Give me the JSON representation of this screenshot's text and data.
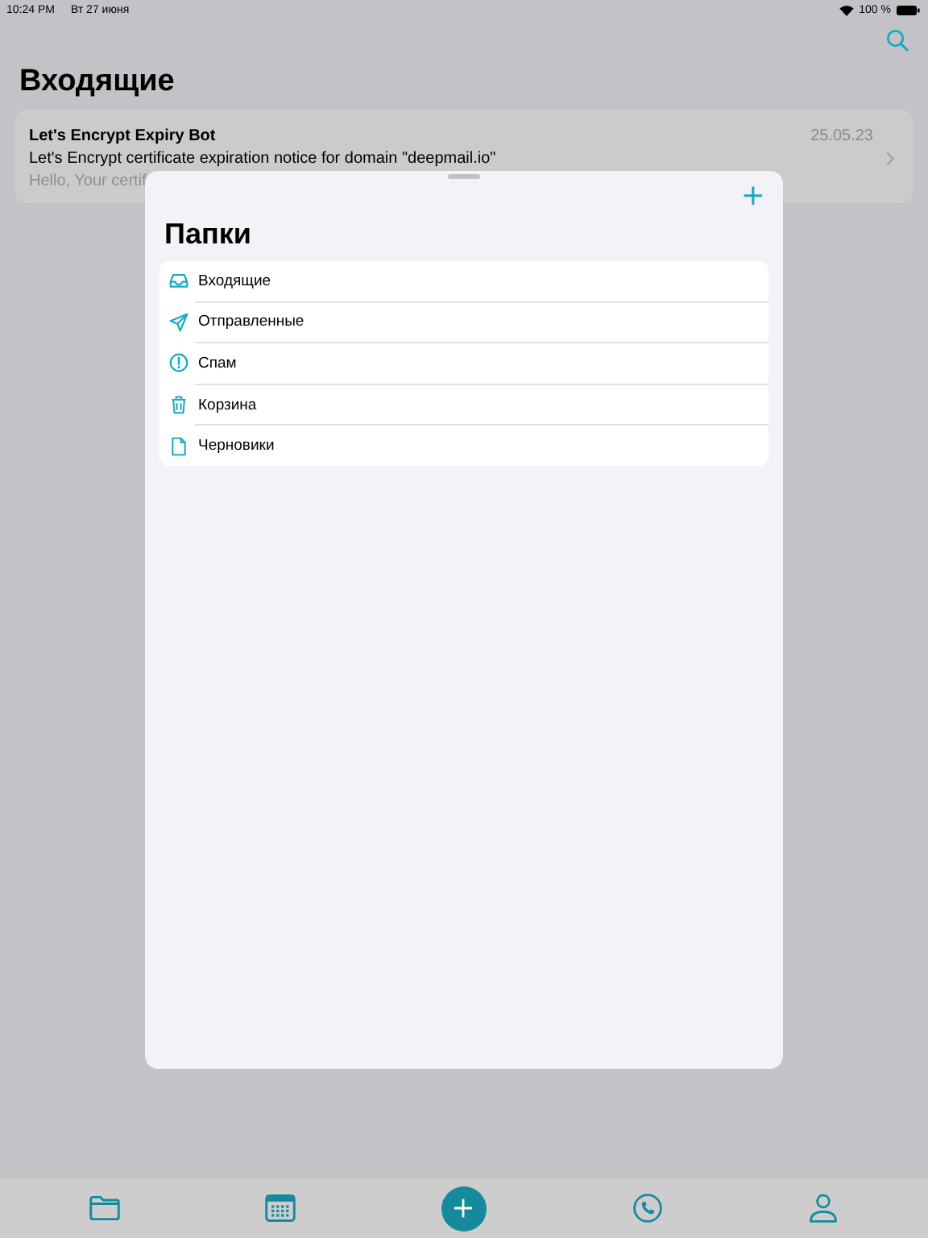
{
  "status_bar": {
    "time": "10:24 PM",
    "date": "Вт 27 июня",
    "battery": "100 %"
  },
  "title": "Входящие",
  "messages": [
    {
      "sender": "Let's Encrypt Expiry Bot",
      "date": "25.05.23",
      "subject": "Let's Encrypt certificate expiration notice for domain \"deepmail.io\"",
      "preview": "Hello, Your certif"
    }
  ],
  "sheet": {
    "title": "Папки",
    "add_button": "+",
    "folders": [
      {
        "kind": "inbox",
        "label": "Входящие"
      },
      {
        "kind": "sent",
        "label": "Отправленные"
      },
      {
        "kind": "spam",
        "label": "Спам"
      },
      {
        "kind": "trash",
        "label": "Корзина"
      },
      {
        "kind": "drafts",
        "label": "Черновики"
      }
    ]
  },
  "tab_bar": [
    {
      "kind": "folder"
    },
    {
      "kind": "calendar"
    },
    {
      "kind": "compose"
    },
    {
      "kind": "phone"
    },
    {
      "kind": "profile"
    }
  ]
}
